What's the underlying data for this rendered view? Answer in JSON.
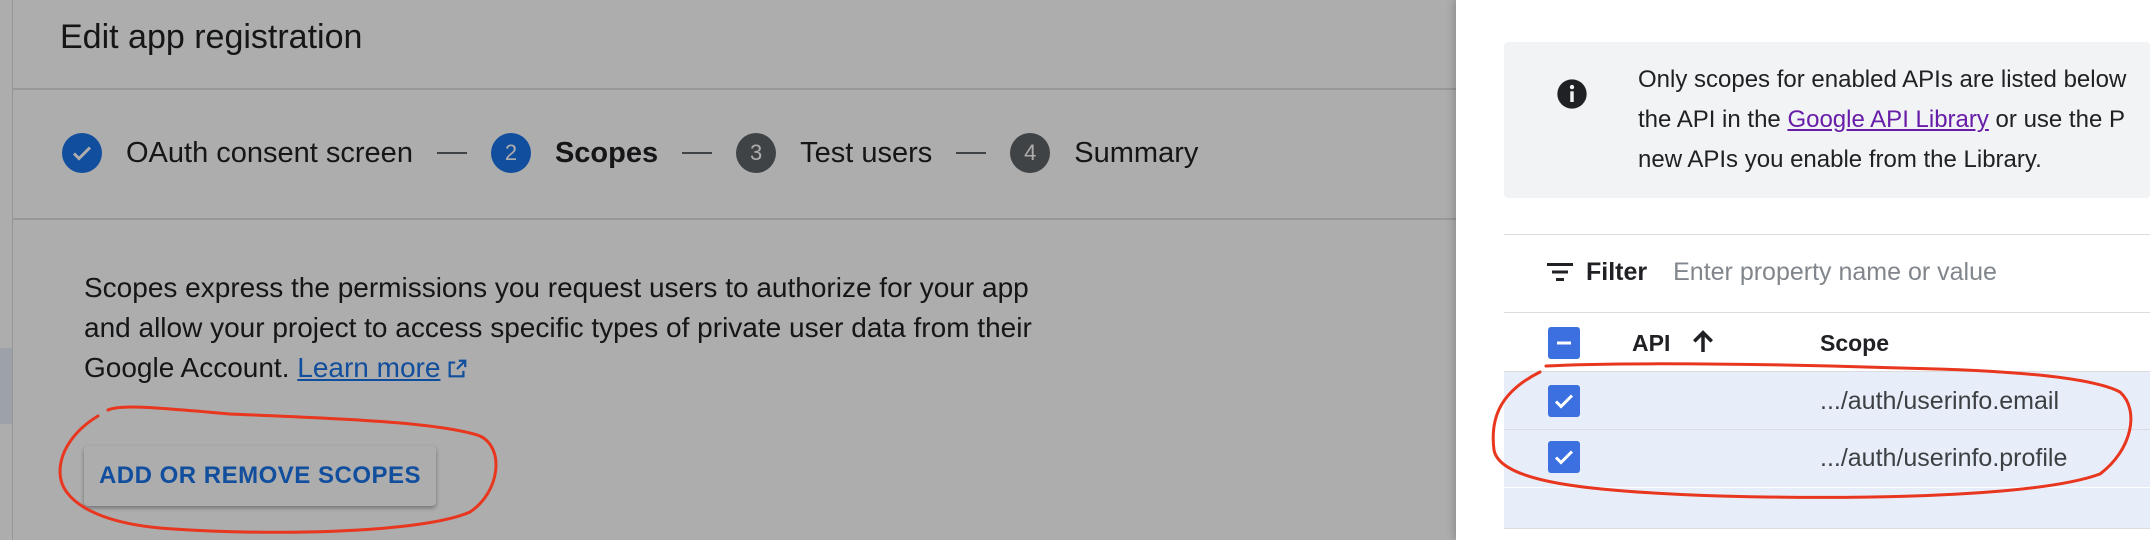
{
  "page": {
    "title": "Edit app registration"
  },
  "stepper": {
    "steps": [
      {
        "label": "OAuth consent screen",
        "number": "",
        "state": "done"
      },
      {
        "label": "Scopes",
        "number": "2",
        "state": "active"
      },
      {
        "label": "Test users",
        "number": "3",
        "state": "todo"
      },
      {
        "label": "Summary",
        "number": "4",
        "state": "todo"
      }
    ]
  },
  "scopes_section": {
    "description": "Scopes express the permissions you request users to authorize for your app and allow your project to access specific types of private user data from their Google Account.",
    "learn_more": "Learn more",
    "add_button": "ADD OR REMOVE SCOPES"
  },
  "panel": {
    "info_text_1": "Only scopes for enabled APIs are listed below",
    "info_text_2a": "the API in the ",
    "info_link": "Google API Library",
    "info_text_2b": " or use the P",
    "info_text_3": "new APIs you enable from the Library.",
    "filter_label": "Filter",
    "filter_placeholder": "Enter property name or value",
    "columns": {
      "api": "API",
      "scope": "Scope"
    },
    "rows": [
      {
        "api": "",
        "scope": ".../auth/userinfo.email",
        "checked": true
      },
      {
        "api": "",
        "scope": ".../auth/userinfo.profile",
        "checked": true
      }
    ]
  },
  "colors": {
    "accent": "#1a73e8",
    "checkbox": "#3c6fe0",
    "annotation": "#e8361f",
    "link_visited": "#681da8"
  },
  "icons": [
    "check-icon",
    "external-link-icon",
    "info-icon",
    "filter-icon",
    "arrow-up-icon",
    "indeterminate-icon"
  ]
}
